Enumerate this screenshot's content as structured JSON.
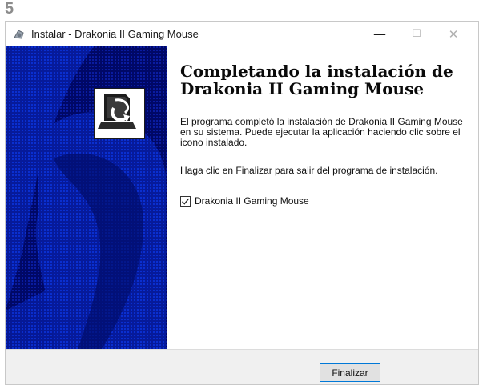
{
  "step_number": "5",
  "window": {
    "title": "Instalar - Drakonia II Gaming Mouse",
    "minimize_glyph": "—",
    "maximize_glyph": "☐",
    "close_glyph": "✕",
    "app_icon": "installer-icon"
  },
  "content": {
    "heading": "Completando la instalación de Drakonia II Gaming Mouse",
    "paragraph1": "El programa completó la instalación de Drakonia II Gaming Mouse en su sistema. Puede ejecutar la aplicación haciendo clic sobre el icono instalado.",
    "paragraph2": "Haga clic en Finalizar para salir del programa de instalación.",
    "checkbox": {
      "label": "Drakonia II Gaming Mouse",
      "checked": true
    }
  },
  "footer": {
    "finish_label": "Finalizar"
  },
  "colors": {
    "side_panel_dark": "#000a66",
    "side_panel_blue": "#0a3fd0",
    "accent_border": "#0078d7"
  }
}
